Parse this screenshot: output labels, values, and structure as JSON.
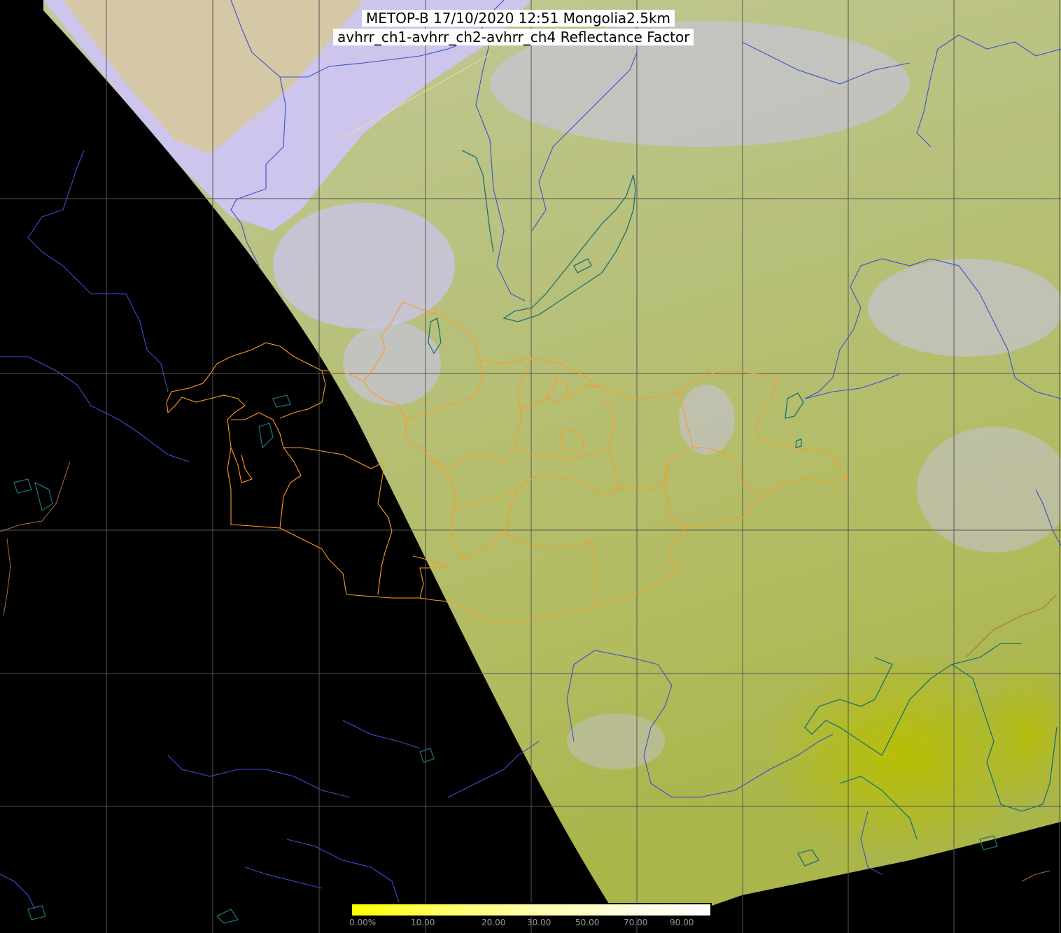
{
  "header": {
    "title_line1": "METOP-B 17/10/2020 12:51 Mongolia2.5km",
    "title_line2": "avhrr_ch1-avhrr_ch2-avhrr_ch4 Reflectance Factor"
  },
  "colorbar": {
    "labels": [
      "0.00%",
      "10.00",
      "20.00",
      "30.00",
      "50.00",
      "70.00",
      "90.00"
    ],
    "colors": [
      "#ffff00",
      "#ffff66",
      "#ffffaa",
      "#ffffdd",
      "#ffffff"
    ]
  },
  "colors": {
    "background": "#000000",
    "land_surface": "#b4bf6c",
    "cloud": "#cbc3ee",
    "grid": "#4d4d4d",
    "rivers": "#3b4fcf",
    "lakes": "#1f6f6f",
    "mongolia_borders": "#ff9a22",
    "country_borders": "#b07040"
  }
}
